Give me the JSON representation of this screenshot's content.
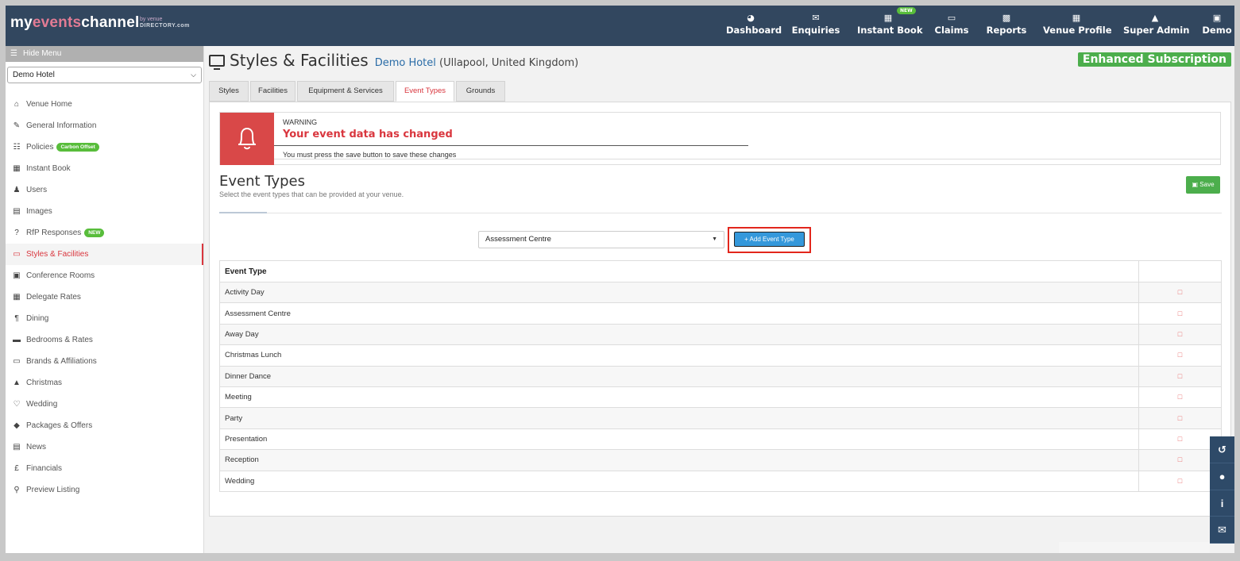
{
  "brand": {
    "logo_prefix": "my",
    "logo_highlight": "events",
    "logo_suffix": "channel",
    "by_text": "by",
    "venue_text": "venue",
    "directory_text": "DIRECTORY.com"
  },
  "nav": [
    {
      "label": "Dashboard",
      "icon": "dashboard-icon"
    },
    {
      "label": "Enquiries",
      "icon": "envelope-icon"
    },
    {
      "label": "Instant Book",
      "icon": "calendar-icon",
      "badge": "NEW"
    },
    {
      "label": "Claims",
      "icon": "book-icon"
    },
    {
      "label": "Reports",
      "icon": "bar-chart-icon"
    },
    {
      "label": "Venue Profile",
      "icon": "building-icon"
    },
    {
      "label": "Super Admin",
      "icon": "lock-icon"
    },
    {
      "label": "Demo",
      "icon": "user-icon"
    }
  ],
  "sidebar": {
    "hide_menu": "Hide Menu",
    "venue": "Demo Hotel",
    "items": [
      {
        "label": "Venue Home",
        "icon": "home-icon"
      },
      {
        "label": "General Information",
        "icon": "edit-icon"
      },
      {
        "label": "Policies",
        "icon": "document-icon",
        "badge": "Carbon Offset"
      },
      {
        "label": "Instant Book",
        "icon": "calendar-icon"
      },
      {
        "label": "Users",
        "icon": "user-icon"
      },
      {
        "label": "Images",
        "icon": "image-icon"
      },
      {
        "label": "RfP Responses",
        "icon": "question-icon",
        "badge": "NEW"
      },
      {
        "label": "Styles & Facilities",
        "icon": "monitor-icon",
        "active": true
      },
      {
        "label": "Conference Rooms",
        "icon": "briefcase-icon"
      },
      {
        "label": "Delegate Rates",
        "icon": "calculator-icon"
      },
      {
        "label": "Dining",
        "icon": "cutlery-icon"
      },
      {
        "label": "Bedrooms & Rates",
        "icon": "bed-icon"
      },
      {
        "label": "Brands & Affiliations",
        "icon": "book-icon"
      },
      {
        "label": "Christmas",
        "icon": "tree-icon"
      },
      {
        "label": "Wedding",
        "icon": "heart-icon"
      },
      {
        "label": "Packages & Offers",
        "icon": "tags-icon"
      },
      {
        "label": "News",
        "icon": "newspaper-icon"
      },
      {
        "label": "Financials",
        "icon": "pound-icon"
      },
      {
        "label": "Preview Listing",
        "icon": "search-icon"
      }
    ]
  },
  "page": {
    "title": "Styles & Facilities",
    "venue_name": "Demo Hotel",
    "venue_location": "(Ullapool, United Kingdom)",
    "subscription": "Enhanced Subscription"
  },
  "tabs": [
    "Styles",
    "Facilities",
    "Equipment & Services",
    "Event Types",
    "Grounds"
  ],
  "active_tab": "Event Types",
  "warning": {
    "label": "WARNING",
    "title": "Your event data has changed",
    "message": "You must press the save button to save these changes"
  },
  "section": {
    "title": "Event Types",
    "subtitle": "Select the event types that can be provided at your venue.",
    "save_label": "Save"
  },
  "event_select": {
    "value": "Assessment Centre"
  },
  "add_button": "+ Add Event Type",
  "table": {
    "header": "Event Type",
    "rows": [
      "Activity Day",
      "Assessment Centre",
      "Away Day",
      "Christmas Lunch",
      "Dinner Dance",
      "Meeting",
      "Party",
      "Presentation",
      "Reception",
      "Wedding"
    ]
  },
  "floating": [
    "history-icon",
    "chat-icon",
    "info-icon",
    "mail-icon"
  ],
  "colors": {
    "topbar": "#32475f",
    "accent_red": "#d9363e",
    "green": "#4cae4c",
    "blue_button": "#3498db"
  }
}
